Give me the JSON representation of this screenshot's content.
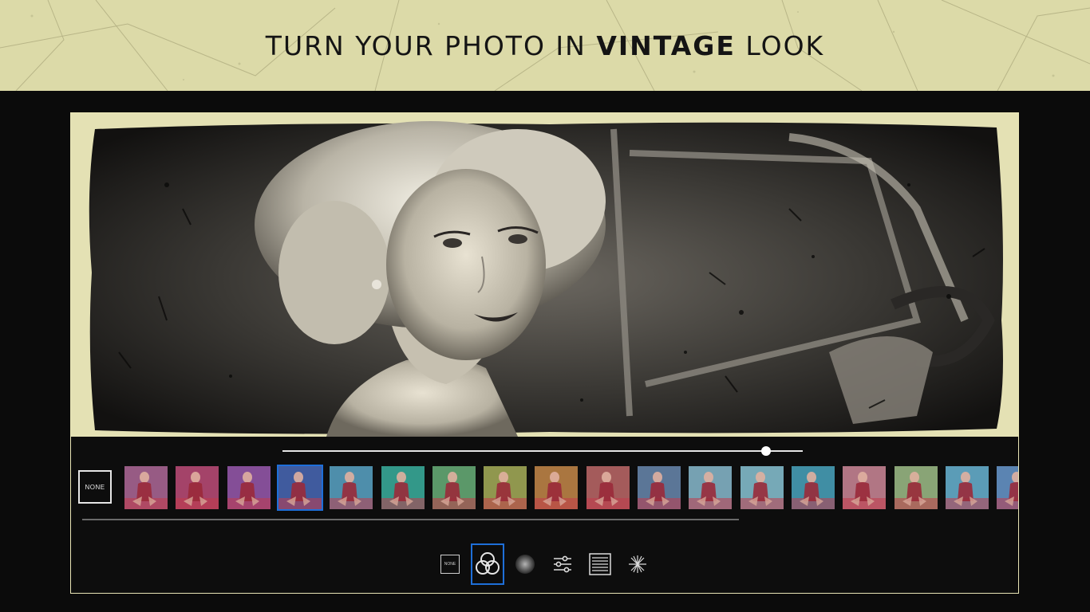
{
  "banner": {
    "title_prefix": "TURN YOUR PHOTO IN ",
    "title_strong": "VINTAGE",
    "title_suffix": " LOOK",
    "background": "#dcdaa8"
  },
  "editor": {
    "frame_color": "#e9e5b6",
    "intensity": 0.93,
    "none_label": "NONE",
    "selected_filter_index": 3,
    "filters": [
      {
        "tint": "#b06a9a"
      },
      {
        "tint": "#c04e7a"
      },
      {
        "tint": "#9a5ab0"
      },
      {
        "tint": "#4a6ab8"
      },
      {
        "tint": "#5aa6c8"
      },
      {
        "tint": "#3bb2a0"
      },
      {
        "tint": "#6ab27a"
      },
      {
        "tint": "#a8b05a"
      },
      {
        "tint": "#c78a4a"
      },
      {
        "tint": "#c06a6a"
      },
      {
        "tint": "#6a8ab0"
      },
      {
        "tint": "#8abcd0"
      },
      {
        "tint": "#8ac6d6"
      },
      {
        "tint": "#4aa6c0"
      },
      {
        "tint": "#cf8a9a"
      },
      {
        "tint": "#a0c08a"
      },
      {
        "tint": "#6ab6d6"
      },
      {
        "tint": "#6a9ad0"
      }
    ]
  },
  "toolbar": {
    "none_label": "NONE",
    "active_tool": "filters",
    "accent": "#1e6fd9",
    "tools": [
      "none-tool",
      "filters-tool",
      "vignette-tool",
      "adjust-tool",
      "texture-tool",
      "light-leak-tool"
    ]
  }
}
